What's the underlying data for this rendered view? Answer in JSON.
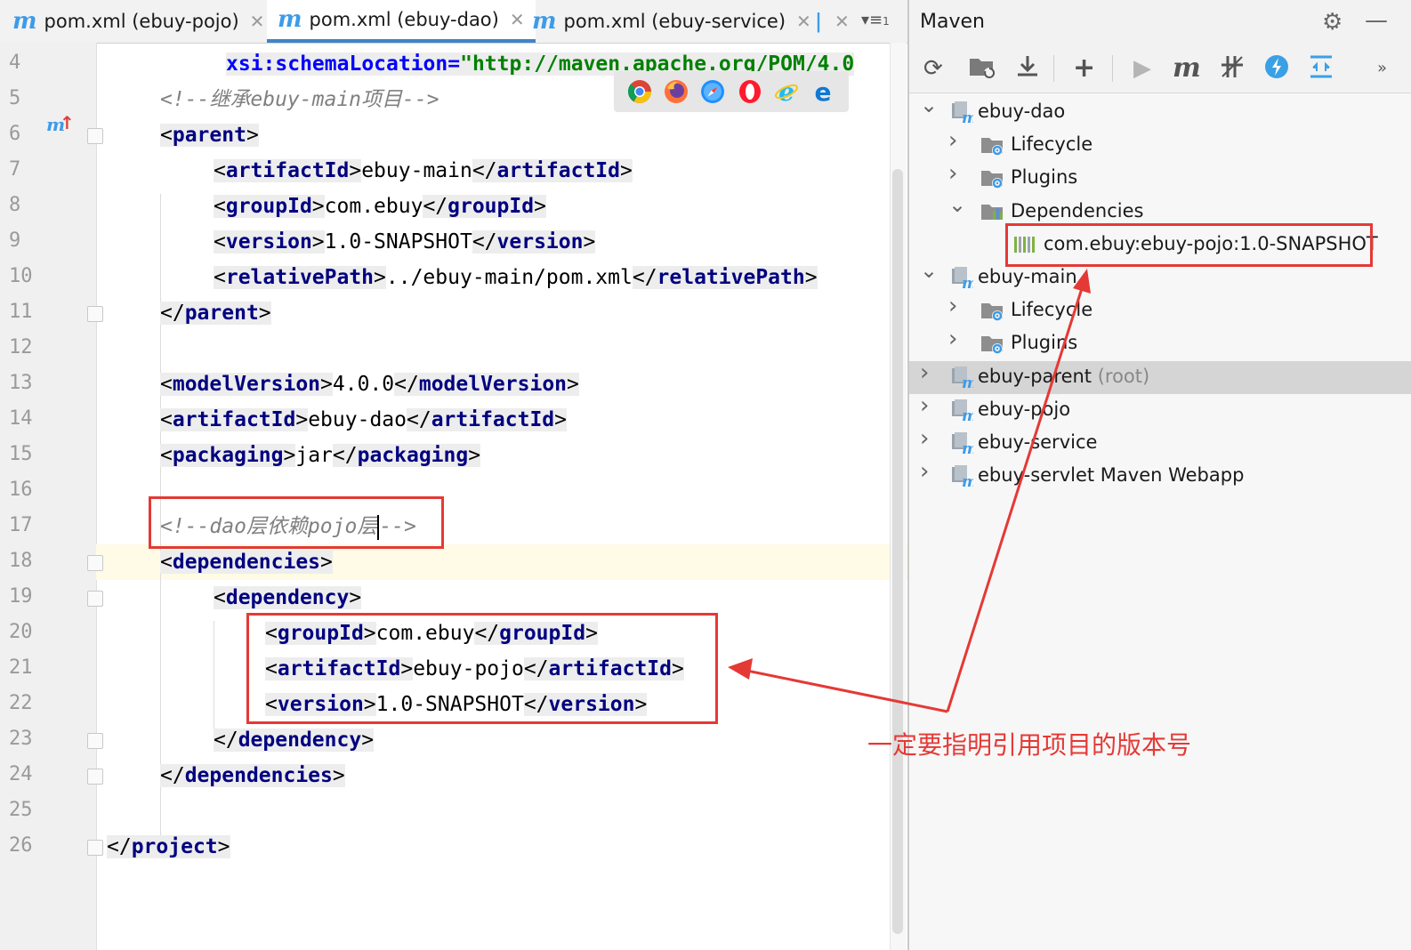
{
  "tabs": [
    {
      "label": "pom.xml (ebuy-pojo)",
      "active": false
    },
    {
      "label": "pom.xml (ebuy-dao)",
      "active": true
    },
    {
      "label": "pom.xml (ebuy-service)",
      "active": false
    }
  ],
  "tab_overflow_count": "1",
  "editor": {
    "line_numbers": [
      "4",
      "5",
      "6",
      "7",
      "8",
      "9",
      "10",
      "11",
      "12",
      "13",
      "14",
      "15",
      "16",
      "17",
      "18",
      "19",
      "20",
      "21",
      "22",
      "23",
      "24",
      "25",
      "26"
    ],
    "lines": {
      "l4_attr": "xsi:schemaLocation=",
      "l4_val": "\"http://maven.apache.org/POM/4.0",
      "l5_comment": "<!--继承ebuy-main项目-->",
      "l6_tag": "parent",
      "l7_tag": "artifactId",
      "l7_text": "ebuy-main",
      "l8_tag": "groupId",
      "l8_text": "com.ebuy",
      "l9_tag": "version",
      "l9_text": "1.0-SNAPSHOT",
      "l10_tag": "relativePath",
      "l10_text": "../ebuy-main/pom.xml",
      "l11_tag": "parent",
      "l13_tag": "modelVersion",
      "l13_text": "4.0.0",
      "l14_tag": "artifactId",
      "l14_text": "ebuy-dao",
      "l15_tag": "packaging",
      "l15_text": "jar",
      "l17_comment_a": "<!--dao层依赖pojo层",
      "l17_comment_b": "-->",
      "l18_tag": "dependencies",
      "l19_tag": "dependency",
      "l20_tag": "groupId",
      "l20_text": "com.ebuy",
      "l21_tag": "artifactId",
      "l21_text": "ebuy-pojo",
      "l22_tag": "version",
      "l22_text": "1.0-SNAPSHOT",
      "l23_tag": "dependency",
      "l24_tag": "dependencies",
      "l26_tag": "project"
    }
  },
  "maven": {
    "title": "Maven",
    "tree": [
      {
        "label": "ebuy-dao",
        "level": 0,
        "expanded": true
      },
      {
        "label": "Lifecycle",
        "level": 1,
        "expanded": false
      },
      {
        "label": "Plugins",
        "level": 1,
        "expanded": false
      },
      {
        "label": "Dependencies",
        "level": 1,
        "expanded": true
      },
      {
        "label": "com.ebuy:ebuy-pojo:1.0-SNAPSHOT",
        "level": 2
      },
      {
        "label": "ebuy-main",
        "level": 0,
        "expanded": true
      },
      {
        "label": "Lifecycle",
        "level": 1,
        "expanded": false
      },
      {
        "label": "Plugins",
        "level": 1,
        "expanded": false
      },
      {
        "label": "ebuy-parent",
        "suffix": "(root)",
        "level": 0,
        "expanded": false,
        "selected": true
      },
      {
        "label": "ebuy-pojo",
        "level": 0,
        "expanded": false
      },
      {
        "label": "ebuy-service",
        "level": 0,
        "expanded": false
      },
      {
        "label": "ebuy-servlet Maven Webapp",
        "level": 0,
        "expanded": false
      }
    ]
  },
  "annotation": {
    "text": "一定要指明引用项目的版本号",
    "color": "#e53935"
  },
  "colors": {
    "tag": "#000080",
    "comment": "#808080",
    "attribute": "#0000ff",
    "attr_value": "#008000",
    "maven_icon": "#3d9be9"
  }
}
